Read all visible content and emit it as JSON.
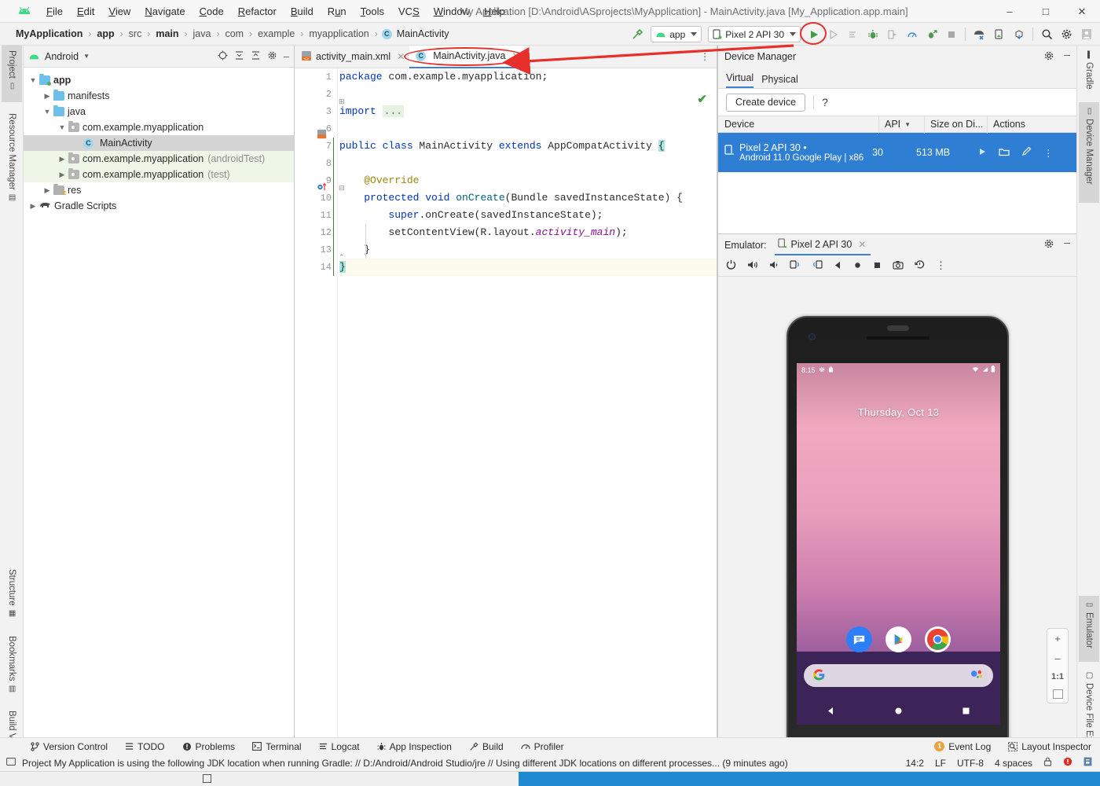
{
  "window": {
    "title": "My Application [D:\\Android\\ASprojects\\MyApplication] - MainActivity.java [My_Application.app.main]",
    "minimize": "–",
    "maximize": "□",
    "close": "✕"
  },
  "menu": [
    "File",
    "Edit",
    "View",
    "Navigate",
    "Code",
    "Refactor",
    "Build",
    "Run",
    "Tools",
    "VCS",
    "Window",
    "Help"
  ],
  "breadcrumb": [
    {
      "label": "MyApplication",
      "bold": true
    },
    {
      "label": "app",
      "bold": true
    },
    {
      "label": "src",
      "bold": false
    },
    {
      "label": "main",
      "bold": true
    },
    {
      "label": "java",
      "bold": false
    },
    {
      "label": "com",
      "bold": false
    },
    {
      "label": "example",
      "bold": false
    },
    {
      "label": "myapplication",
      "bold": false
    },
    {
      "label": "MainActivity",
      "bold": false,
      "icon": "class-icon"
    }
  ],
  "toolbar": {
    "build_icon": "hammer-icon",
    "module_config": "app",
    "device_config": "Pixel 2 API 30",
    "run_icon": "run-play-icon",
    "run_highlighted": true,
    "attach_debugger_icon": "attach-debugger-icon",
    "run_with_coverage_icon": "coverage-icon",
    "debug_icon": "debug-bug-icon",
    "apply_changes_icon": "apply-changes-icon",
    "profiler_icon": "profiler-icon",
    "apply_code_changes_icon": "apply-code-changes-icon",
    "stop_icon": "stop-icon",
    "sdk_manager_icon": "sdk-manager-icon",
    "avd_manager_icon": "avd-manager-icon",
    "sync_gradle_icon": "sync-gradle-icon",
    "search_icon": "search-icon",
    "settings_icon": "gear-icon",
    "account_icon": "account-icon"
  },
  "left_strip": {
    "top": [
      {
        "label": "Project",
        "icon": "project-icon",
        "active": true
      },
      {
        "label": "Resource Manager",
        "icon": "resource-manager-icon",
        "active": false
      }
    ],
    "bottom": [
      {
        "label": "Structure",
        "icon": "structure-icon"
      },
      {
        "label": "Bookmarks",
        "icon": "bookmarks-icon"
      },
      {
        "label": "Build Variants",
        "icon": "build-variants-icon"
      }
    ]
  },
  "right_strip": {
    "top": [
      {
        "label": "Gradle",
        "icon": "gradle-elephant-icon",
        "active": false
      },
      {
        "label": "Device Manager",
        "icon": "device-manager-icon",
        "active": true
      }
    ],
    "bottom": [
      {
        "label": "Emulator",
        "icon": "emulator-icon",
        "active": true
      },
      {
        "label": "Device File Explorer",
        "icon": "device-file-explorer-icon",
        "active": false
      }
    ]
  },
  "project_panel": {
    "title": "Android",
    "dropdown_icon": "chevron-down-icon",
    "icons": [
      "select-opened-file-icon",
      "expand-all-icon",
      "collapse-all-icon",
      "gear-icon",
      "hide-icon"
    ],
    "tree": [
      {
        "depth": 0,
        "arrow": "expanded",
        "icon": "folder-app",
        "label": "app",
        "bold": true,
        "sub": "",
        "selected": false,
        "test": false
      },
      {
        "depth": 1,
        "arrow": "collapsed",
        "icon": "folder-blue",
        "label": "manifests",
        "bold": false,
        "sub": "",
        "selected": false,
        "test": false
      },
      {
        "depth": 1,
        "arrow": "expanded",
        "icon": "folder-blue",
        "label": "java",
        "bold": false,
        "sub": "",
        "selected": false,
        "test": false
      },
      {
        "depth": 2,
        "arrow": "expanded",
        "icon": "folder-pkg",
        "label": "com.example.myapplication",
        "bold": false,
        "sub": "",
        "selected": false,
        "test": false
      },
      {
        "depth": 3,
        "arrow": "none",
        "icon": "class-icon",
        "label": "MainActivity",
        "bold": false,
        "sub": "",
        "selected": true,
        "test": false
      },
      {
        "depth": 2,
        "arrow": "collapsed",
        "icon": "folder-pkg",
        "label": "com.example.myapplication",
        "bold": false,
        "sub": "(androidTest)",
        "selected": false,
        "test": true
      },
      {
        "depth": 2,
        "arrow": "collapsed",
        "icon": "folder-pkg",
        "label": "com.example.myapplication",
        "bold": false,
        "sub": "(test)",
        "selected": false,
        "test": true
      },
      {
        "depth": 1,
        "arrow": "collapsed",
        "icon": "folder-res",
        "label": "res",
        "bold": false,
        "sub": "",
        "selected": false,
        "test": false
      },
      {
        "depth": 0,
        "arrow": "collapsed",
        "icon": "gradle-elephant-icon",
        "label": "Gradle Scripts",
        "bold": false,
        "sub": "",
        "selected": false,
        "test": false
      }
    ]
  },
  "editor": {
    "tabs": [
      {
        "label": "activity_main.xml",
        "icon": "xml-layout-icon",
        "active": false,
        "close": "✕"
      },
      {
        "label": "MainActivity.java",
        "icon": "java-class-icon",
        "active": true,
        "close": "✕",
        "highlighted": true
      }
    ],
    "tab_menu_icon": "more-vertical-icon",
    "inspection_status_icon": "check-ok-icon",
    "line_numbers": [
      "1",
      "2",
      "3",
      "6",
      "7",
      "8",
      "9",
      "10",
      "11",
      "12",
      "13",
      "14"
    ],
    "current_line": 14,
    "lines": [
      "package com.example.myapplication;",
      "",
      "import ...",
      "",
      "public class MainActivity extends AppCompatActivity {",
      "",
      "    @Override",
      "    protected void onCreate(Bundle savedInstanceState) {",
      "        super.onCreate(savedInstanceState);",
      "        setContentView(R.layout.activity_main);",
      "    }",
      "}"
    ]
  },
  "device_manager": {
    "title": "Device Manager",
    "gear_icon": "gear-icon",
    "hide_icon": "hide-icon",
    "tabs": [
      {
        "label": "Virtual",
        "active": true
      },
      {
        "label": "Physical",
        "active": false
      }
    ],
    "create_device_label": "Create device",
    "help_label": "?",
    "columns": [
      "Device",
      "API",
      "Size on Di...",
      "Actions"
    ],
    "sort_icon": "sort-desc-icon",
    "rows": [
      {
        "icon": "virtual-device-icon",
        "name": "Pixel 2 API 30",
        "online_dot": "•",
        "detail": "Android 11.0 Google Play | x86",
        "api": "30",
        "size": "513 MB",
        "actions": [
          "launch-icon",
          "folder-icon",
          "edit-pencil-icon",
          "more-vertical-icon"
        ],
        "selected": true
      }
    ]
  },
  "emulator": {
    "label": "Emulator:",
    "tab": "Pixel 2 API 30",
    "tab_close": "✕",
    "tab_icon": "virtual-device-icon",
    "gear_icon": "gear-icon",
    "hide_icon": "hide-icon",
    "toolbar_icons": [
      "power-icon",
      "volume-up-icon",
      "volume-down-icon",
      "rotate-left-icon",
      "rotate-right-icon",
      "back-icon",
      "home-icon",
      "overview-icon",
      "screenshot-icon",
      "history-icon",
      "more-vertical-icon"
    ],
    "zoom_controls": [
      "+",
      "–",
      "1:1",
      "fit-icon"
    ],
    "screen": {
      "status_time": "8:15",
      "status_icons_left": [
        "settings-icon",
        "bag-icon"
      ],
      "status_icons_right": [
        "wifi-icon",
        "signal-icon",
        "battery-icon"
      ],
      "date_text": "Thursday, Oct 13",
      "app_icons": [
        "messages-icon",
        "play-store-icon",
        "chrome-icon"
      ],
      "search_left_icon": "google-g-icon",
      "search_right_icon": "google-assistant-icon",
      "nav_icons": [
        "back-triangle-icon",
        "home-circle-icon",
        "recents-square-icon"
      ]
    }
  },
  "bottom_bar": [
    {
      "label": "Version Control",
      "icon": "branch-icon"
    },
    {
      "label": "TODO",
      "icon": "todo-list-icon"
    },
    {
      "label": "Problems",
      "icon": "problems-icon"
    },
    {
      "label": "Terminal",
      "icon": "terminal-icon"
    },
    {
      "label": "Logcat",
      "icon": "logcat-icon"
    },
    {
      "label": "App Inspection",
      "icon": "app-inspection-icon"
    },
    {
      "label": "Build",
      "icon": "hammer-icon"
    },
    {
      "label": "Profiler",
      "icon": "profiler-icon"
    }
  ],
  "bottom_bar_right": [
    {
      "label": "Event Log",
      "icon": "event-log-badge-icon",
      "badge": "1"
    },
    {
      "label": "Layout Inspector",
      "icon": "layout-inspector-icon"
    }
  ],
  "status_bar": {
    "icon": "message-icon",
    "message": "Project My Application is using the following JDK location when running Gradle: // D:/Android/Android Studio/jre // Using different JDK locations on different processes... (9 minutes ago)",
    "caret": "14:2",
    "line_sep": "LF",
    "encoding": "UTF-8",
    "indent": "4 spaces",
    "lock_icon": "lock-icon",
    "error_icon": "error-circle-icon",
    "notification_icon": "notification-icon"
  },
  "colors": {
    "accent_blue": "#2e7fd4",
    "tab_underline": "#3f7fd4",
    "annotation_red": "#e8302a",
    "android_green": "#3ddc84",
    "selection_green": "#eef7e7",
    "keyword_blue": "#0033b3",
    "field_purple": "#871094",
    "annotation_gold": "#9e880d"
  }
}
